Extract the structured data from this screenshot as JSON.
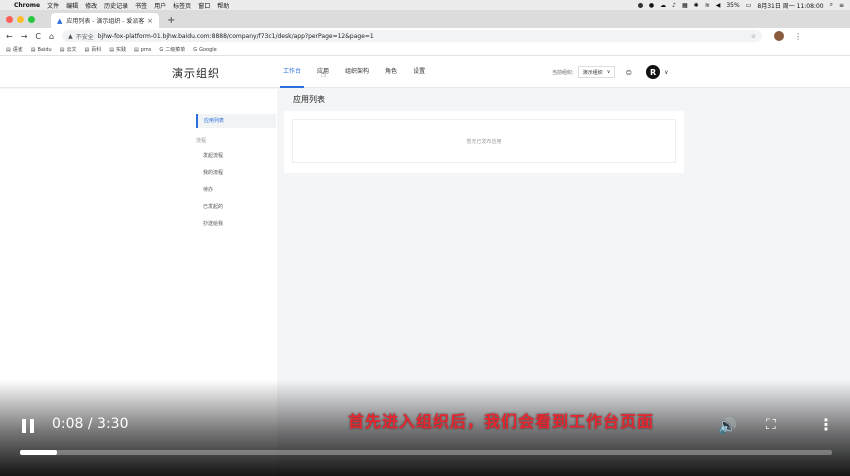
{
  "mac_menubar": {
    "app_name": "Chrome",
    "menus": [
      "文件",
      "编辑",
      "修改",
      "历史记录",
      "书签",
      "用户",
      "标签页",
      "窗口",
      "帮助"
    ],
    "battery": "35%",
    "datetime": "8月31日 周一 11:08:00"
  },
  "browser": {
    "tab_title": "应用列表 - 演示组织 - 爱派客",
    "insecure_label": "不安全",
    "url": "bjhw-fox-platform-01.bjhw.baidu.com:8888/company/f73c1/desk/app?perPage=12&page=1",
    "bookmarks": [
      "语雀",
      "Baidu",
      "云文",
      "百科",
      "实践",
      "pms",
      "二级菜单",
      "Google"
    ]
  },
  "app": {
    "org_title": "演示组织",
    "nav": [
      "工作台",
      "应用",
      "组织架构",
      "角色",
      "设置"
    ],
    "current_org_label": "当前组织:",
    "current_org_value": "演示组织",
    "user_initial": "R",
    "sidebar": {
      "active_item": "应用列表",
      "group_label": "流程",
      "items": [
        "发起流程",
        "我的流程",
        "待办",
        "已发起的",
        "抄送给我"
      ]
    },
    "page_title": "应用列表",
    "empty_text": "暂无已发布应用"
  },
  "video": {
    "subtitle": "首先进入组织后，我们会看到工作台页面",
    "time": "0:08 / 3:30",
    "progress_fraction": 0.046
  },
  "colors": {
    "accent": "#2a6fdb",
    "subtitle": "#e8262f"
  }
}
